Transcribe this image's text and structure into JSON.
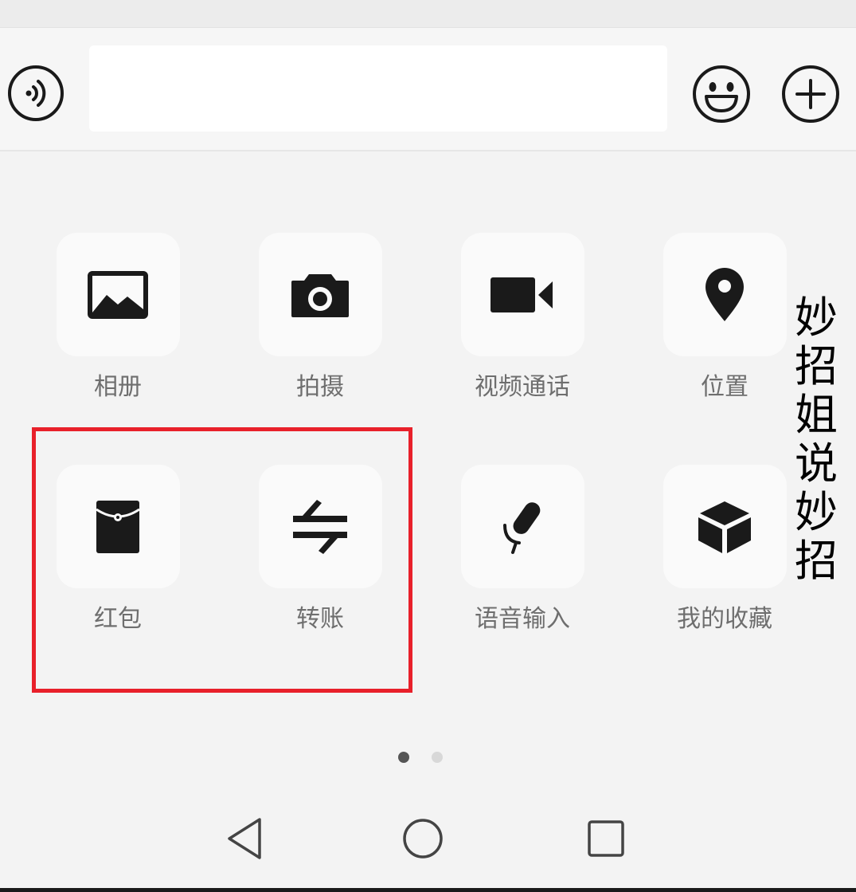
{
  "colors": {
    "background": "#f3f3f3",
    "icon": "#1a1a1a",
    "label": "#6e6e6e",
    "highlight_border": "#e8202a",
    "dot_active": "#555555",
    "dot_inactive": "#d8d8d8"
  },
  "input_bar": {
    "voice_icon": "voice-input-icon",
    "text_value": "",
    "emoji_icon": "emoji-icon",
    "plus_icon": "plus-circle-icon"
  },
  "panel": {
    "tiles": [
      {
        "label": "相册",
        "icon": "album-icon"
      },
      {
        "label": "拍摄",
        "icon": "camera-icon"
      },
      {
        "label": "视频通话",
        "icon": "video-call-icon"
      },
      {
        "label": "位置",
        "icon": "location-icon"
      },
      {
        "label": "红包",
        "icon": "red-packet-icon"
      },
      {
        "label": "转账",
        "icon": "transfer-icon"
      },
      {
        "label": "语音输入",
        "icon": "voice-dictation-icon"
      },
      {
        "label": "我的收藏",
        "icon": "favorites-icon"
      }
    ],
    "page_indicator": {
      "current_page": 1,
      "total_pages": 2
    }
  },
  "watermark": {
    "text": "妙招姐说妙招"
  },
  "navbar": {
    "back_icon": "back-triangle-icon",
    "home_icon": "home-circle-icon",
    "recents_icon": "recents-square-icon"
  }
}
